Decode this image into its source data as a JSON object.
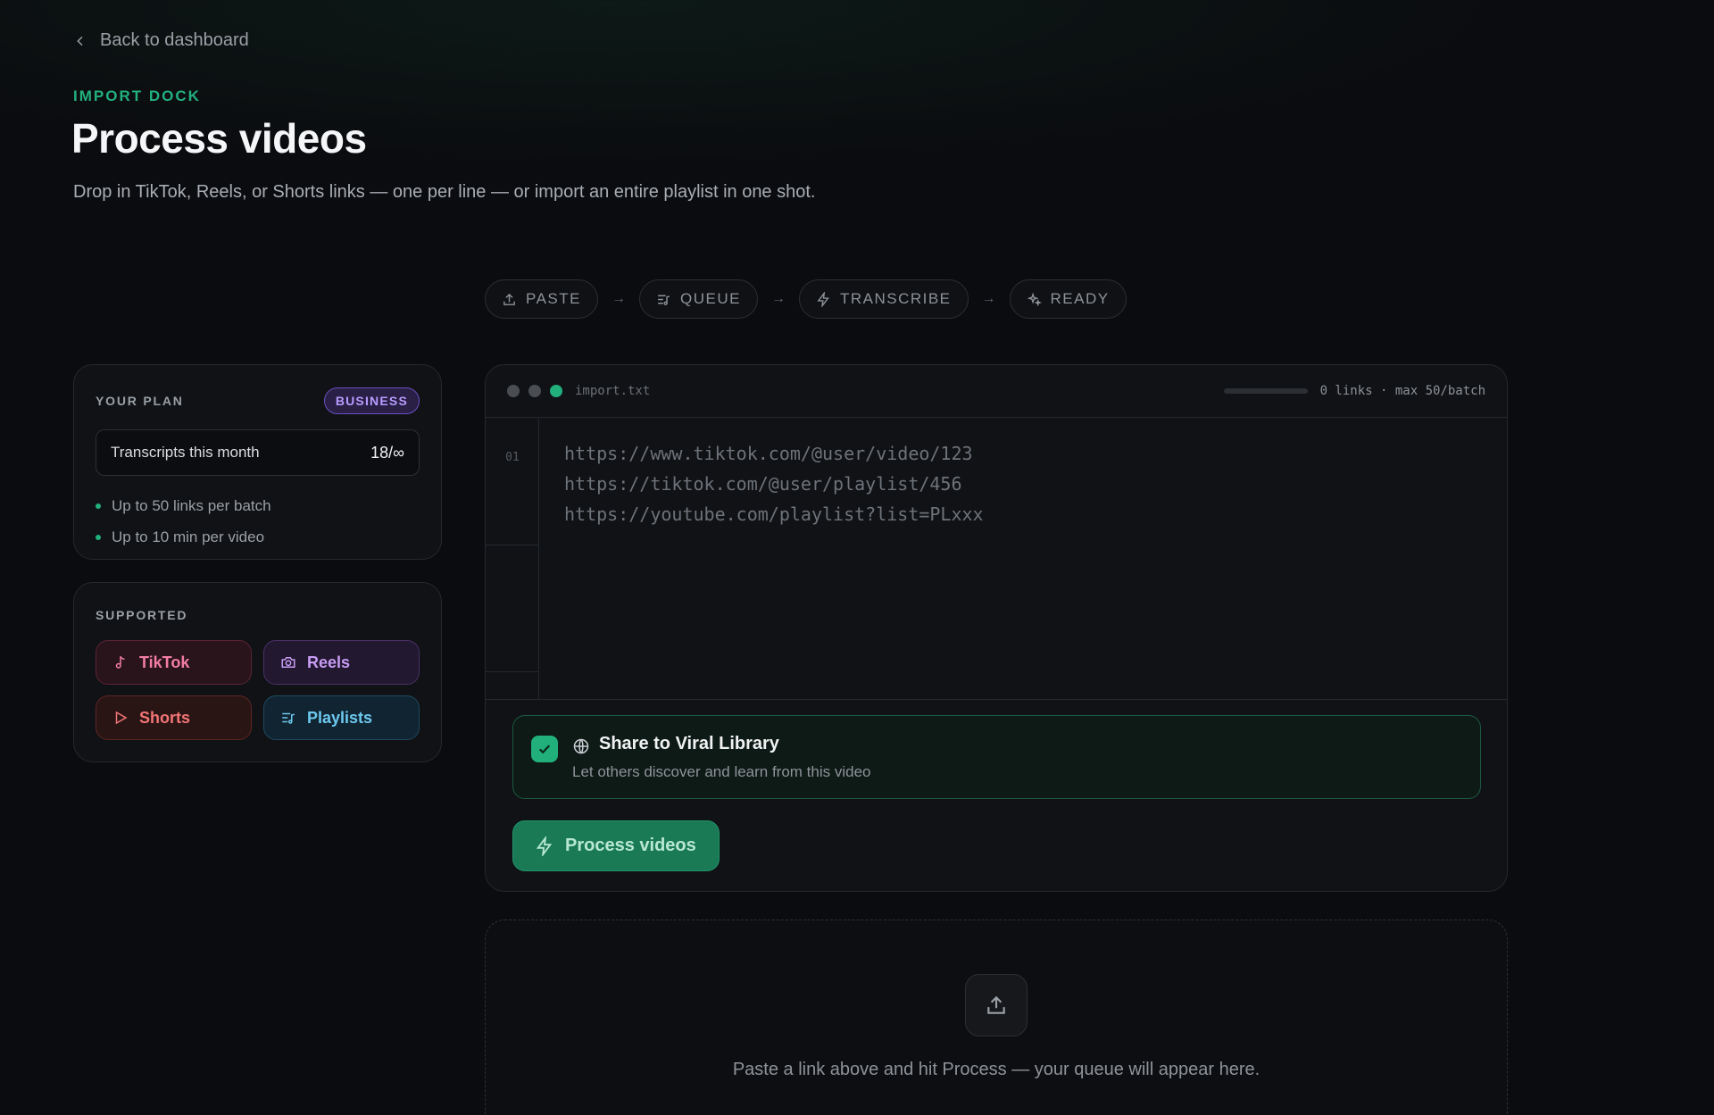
{
  "nav": {
    "back_label": "Back to dashboard"
  },
  "header": {
    "eyebrow": "IMPORT DOCK",
    "title": "Process videos",
    "subtitle": "Drop in TikTok, Reels, or Shorts links — one per line — or import an entire playlist in one shot."
  },
  "steps": [
    {
      "label": "PASTE",
      "icon": "upload-icon"
    },
    {
      "label": "QUEUE",
      "icon": "list-music-icon"
    },
    {
      "label": "TRANSCRIBE",
      "icon": "bolt-icon"
    },
    {
      "label": "READY",
      "icon": "sparkles-icon"
    }
  ],
  "plan": {
    "label": "YOUR PLAN",
    "badge": "BUSINESS",
    "usage_label": "Transcripts this month",
    "usage_value": "18/∞",
    "features": [
      "Up to 50 links per batch",
      "Up to 10 min per video"
    ]
  },
  "supported": {
    "label": "SUPPORTED",
    "platforms": [
      {
        "label": "TikTok",
        "icon": "music-note-icon"
      },
      {
        "label": "Reels",
        "icon": "camera-icon"
      },
      {
        "label": "Shorts",
        "icon": "play-icon"
      },
      {
        "label": "Playlists",
        "icon": "list-music-icon"
      }
    ]
  },
  "editor": {
    "filename": "import.txt",
    "meta": "0 links · max 50/batch",
    "link_progress": 0,
    "line_number": "01",
    "placeholder_lines": [
      "https://www.tiktok.com/@user/video/123",
      "https://tiktok.com/@user/playlist/456",
      "https://youtube.com/playlist?list=PLxxx"
    ],
    "share": {
      "checked": true,
      "title": "Share to Viral Library",
      "subtitle": "Let others discover and learn from this video"
    },
    "process_label": "Process videos"
  },
  "queue": {
    "empty_text": "Paste a link above and hit Process — your queue will appear here."
  },
  "colors": {
    "accent": "#22b07d",
    "background": "#0b0c0f",
    "badge": "#b79cff",
    "tiktok": "#f27da6",
    "reels": "#c89cf5",
    "shorts": "#f27575",
    "playlists": "#6cc8ee"
  }
}
